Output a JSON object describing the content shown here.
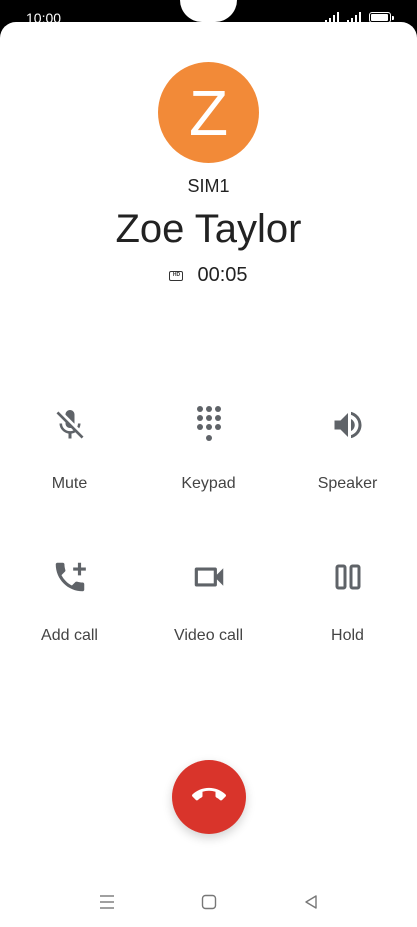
{
  "status_bar": {
    "time": "10:00"
  },
  "caller": {
    "avatar_letter": "Z",
    "avatar_color": "#f28a38",
    "sim": "SIM1",
    "name": "Zoe Taylor",
    "hd_badge": "HD",
    "duration": "00:05"
  },
  "controls": [
    {
      "label": "Mute",
      "icon": "mic-off-icon"
    },
    {
      "label": "Keypad",
      "icon": "dialpad-icon"
    },
    {
      "label": "Speaker",
      "icon": "speaker-icon"
    },
    {
      "label": "Add call",
      "icon": "add-call-icon"
    },
    {
      "label": "Video call",
      "icon": "video-camera-icon"
    },
    {
      "label": "Hold",
      "icon": "pause-icon"
    }
  ],
  "end_call": {
    "icon": "call-end-icon",
    "color": "#d9342b"
  },
  "navigation": {
    "icons": [
      "menu-icon",
      "home-icon",
      "back-icon"
    ]
  }
}
